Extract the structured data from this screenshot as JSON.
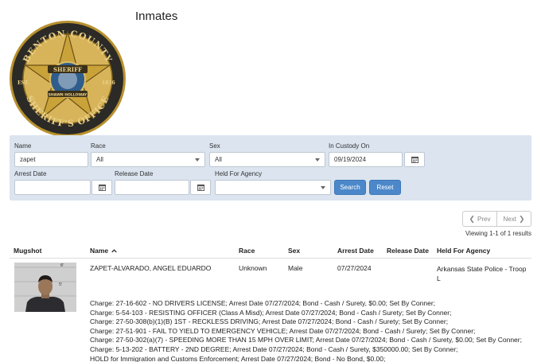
{
  "page": {
    "title": "Inmates",
    "badge_text": {
      "top": "BENTON COUNTY",
      "center": "SHERIFF",
      "name": "SHAWN HOLLOWAY",
      "est": "EST.",
      "year": "1836",
      "bottom": "SHERIFF'S OFFICE"
    }
  },
  "filters": {
    "name": {
      "label": "Name",
      "value": "zapet"
    },
    "race": {
      "label": "Race",
      "value": "All"
    },
    "sex": {
      "label": "Sex",
      "value": "All"
    },
    "in_custody": {
      "label": "In Custody On",
      "value": "09/19/2024"
    },
    "arrest_date": {
      "label": "Arrest Date",
      "value": ""
    },
    "release_date": {
      "label": "Release Date",
      "value": ""
    },
    "held_for_agency": {
      "label": "Held For Agency",
      "value": ""
    },
    "search_label": "Search",
    "reset_label": "Reset"
  },
  "pagination": {
    "prev_label": "Prev",
    "next_label": "Next",
    "results_text": "Viewing 1-1 of 1 results"
  },
  "table": {
    "columns": [
      "Mugshot",
      "Name",
      "Race",
      "Sex",
      "Arrest Date",
      "Release Date",
      "Held For Agency"
    ],
    "rows": [
      {
        "name": "ZAPET-ALVARADO, ANGEL EDUARDO",
        "race": "Unknown",
        "sex": "Male",
        "arrest_date": "07/27/2024",
        "release_date": "",
        "agency_line1": "Arkansas State Police - Troop",
        "agency_line2": "L",
        "mugshot_marks": [
          "6'",
          "5'"
        ],
        "charges": [
          "Charge: 27-16-602 - NO DRIVERS LICENSE; Arrest Date 07/27/2024; Bond - Cash / Surety, $0.00; Set By Conner;",
          "Charge: 5-54-103 - RESISTING OFFICER (Class A Misd); Arrest Date 07/27/2024; Bond - Cash / Surety; Set By Conner;",
          "Charge: 27-50-308(b)(1)(B) 1ST - RECKLESS DRIVING; Arrest Date 07/27/2024; Bond - Cash / Surety; Set By Conner;",
          "Charge: 27-51-901 - FAIL TO YIELD TO EMERGENCY VEHICLE; Arrest Date 07/27/2024; Bond - Cash / Surety; Set By Conner;",
          "Charge: 27-50-302(a)(7) - SPEEDING MORE THAN 15 MPH OVER LIMIT; Arrest Date 07/27/2024; Bond - Cash / Surety, $0.00; Set By Conner;",
          "Charge: 5-13-202 - BATTERY - 2ND DEGREE; Arrest Date 07/27/2024; Bond - Cash / Surety, $350000.00; Set By Conner;",
          "HOLD for Immigration and Customs Enforcement; Arrest Date 07/27/2024; Bond - No Bond, $0.00;"
        ]
      }
    ]
  },
  "colors": {
    "panel_bg": "#dbe4ef",
    "button_blue": "#4c88c9",
    "badge_gold": "#c9a23a",
    "badge_dark": "#2a2a2a"
  }
}
